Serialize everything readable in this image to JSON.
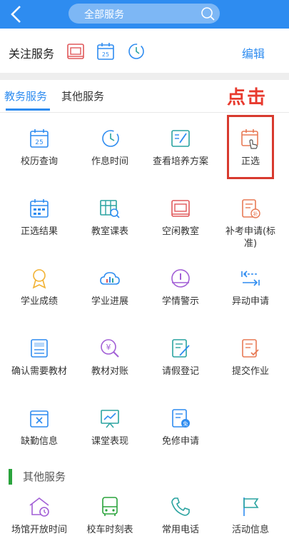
{
  "header": {
    "search_text": "全部服务"
  },
  "favorites": {
    "title": "关注服务",
    "edit_label": "编辑"
  },
  "tabs": [
    {
      "label": "教务服务"
    },
    {
      "label": "其他服务"
    }
  ],
  "annotation": {
    "tap_hint": "点击"
  },
  "services": [
    {
      "label": "校历查询",
      "icon": "calendar-25-icon"
    },
    {
      "label": "作息时间",
      "icon": "clock-icon"
    },
    {
      "label": "查看培养方案",
      "icon": "plan-edit-icon"
    },
    {
      "label": "正选",
      "icon": "select-calendar-icon"
    },
    {
      "label": "正选结果",
      "icon": "result-calendar-icon"
    },
    {
      "label": "教室课表",
      "icon": "classroom-schedule-icon"
    },
    {
      "label": "空闲教室",
      "icon": "free-classroom-icon"
    },
    {
      "label": "补考申请(标准)",
      "icon": "makeup-exam-icon"
    },
    {
      "label": "学业成绩",
      "icon": "award-icon"
    },
    {
      "label": "学业进展",
      "icon": "progress-cloud-icon"
    },
    {
      "label": "学情警示",
      "icon": "warning-icon"
    },
    {
      "label": "异动申请",
      "icon": "transfer-arrows-icon"
    },
    {
      "label": "确认需要教材",
      "icon": "textbook-icon"
    },
    {
      "label": "教材对账",
      "icon": "yen-search-icon"
    },
    {
      "label": "请假登记",
      "icon": "leave-edit-icon"
    },
    {
      "label": "提交作业",
      "icon": "homework-check-icon"
    },
    {
      "label": "缺勤信息",
      "icon": "absence-icon"
    },
    {
      "label": "课堂表现",
      "icon": "class-performance-icon"
    },
    {
      "label": "免修申请",
      "icon": "exemption-icon"
    }
  ],
  "other_section": {
    "title": "其他服务"
  },
  "other_services": [
    {
      "label": "场馆开放时间",
      "icon": "venue-time-icon"
    },
    {
      "label": "校车时刻表",
      "icon": "school-bus-icon"
    },
    {
      "label": "常用电话",
      "icon": "phone-icon"
    },
    {
      "label": "活动信息",
      "icon": "activity-flag-icon"
    }
  ],
  "colors": {
    "primary": "#2e8cf0",
    "accent_red": "#e83a2e",
    "section_green": "#2aa33c"
  }
}
